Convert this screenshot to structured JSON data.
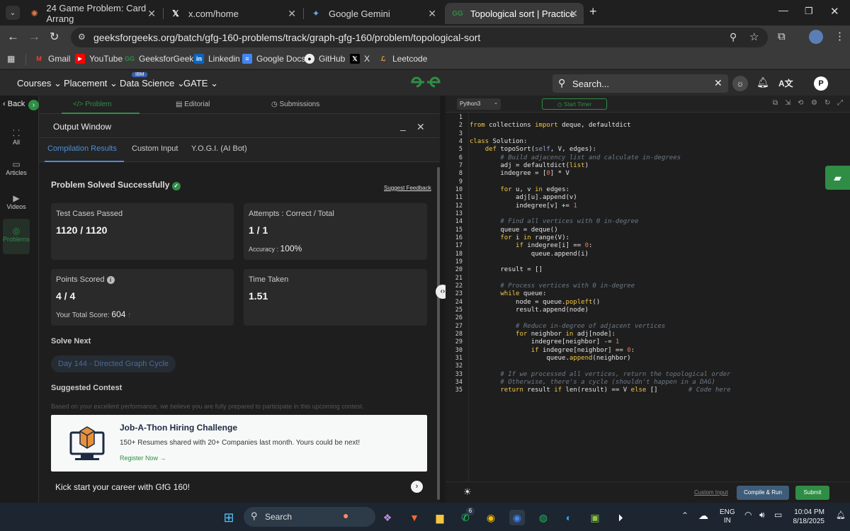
{
  "browser": {
    "tabs": [
      {
        "title": "24 Game Problem: Card Arrang"
      },
      {
        "title": "x.com/home"
      },
      {
        "title": "Google Gemini"
      },
      {
        "title": "Topological sort | Practice | Gee"
      }
    ],
    "new_tab": "+",
    "url": "geeksforgeeks.org/batch/gfg-160-problems/track/graph-gfg-160/problem/topological-sort",
    "profile_initial": "P",
    "bookmarks": [
      "Gmail",
      "YouTube",
      "GeeksforGeeks",
      "Linkedin",
      "Google Docs",
      "GitHub",
      "X",
      "Leetcode"
    ]
  },
  "site": {
    "nav": [
      "Courses",
      "Placement",
      "Data Science",
      "GATE"
    ],
    "ibm_badge": "IBM",
    "logo": "GfG",
    "search_placeholder": "Search...",
    "avatar": "P"
  },
  "sidebar": {
    "back": "Back",
    "items": [
      "All",
      "Articles",
      "Videos",
      "Problems"
    ]
  },
  "problem_tabs": [
    "Problem",
    "Editorial",
    "Submissions"
  ],
  "output": {
    "title": "Output Window",
    "tabs": [
      "Compilation Results",
      "Custom Input",
      "Y.O.G.I. (AI Bot)"
    ],
    "status": "Problem Solved Successfully",
    "suggest_feedback": "Suggest Feedback",
    "test_cases_label": "Test Cases Passed",
    "test_cases_value": "1120 / 1120",
    "attempts_label": "Attempts : Correct / Total",
    "attempts_value": "1 / 1",
    "accuracy_label": "Accuracy :",
    "accuracy_value": "100%",
    "points_label": "Points Scored",
    "points_value": "4 / 4",
    "total_score_label": "Your Total Score:",
    "total_score_value": "604",
    "time_label": "Time Taken",
    "time_value": "1.51",
    "solve_next_heading": "Solve Next",
    "solve_next_item": "Day 144 - Directed Graph Cycle",
    "contest_heading": "Suggested Contest",
    "contest_text": "Based on your excellent performance, we believe you are fully prepared to participate in this upcoming contest.",
    "banner_title": "Job-A-Thon Hiring Challenge",
    "banner_text": "150+ Resumes shared with 20+ Companies last month. Yours could be next!",
    "banner_link": "Register Now →",
    "kick_text": "Kick start your career with GfG 160!"
  },
  "editor": {
    "language": "Python3",
    "start_timer": "Start Timer",
    "custom_input": "Custom Input",
    "compile_run": "Compile & Run",
    "submit": "Submit"
  },
  "taskbar": {
    "search": "Search",
    "whatsapp_badge": "6",
    "lang_1": "ENG",
    "lang_2": "IN",
    "time": "10:04 PM",
    "date": "8/18/2025"
  },
  "colors": {
    "gfg_green": "#2f8d46",
    "submit_green": "#2f8d46",
    "compile_blue": "#3f5d7a"
  }
}
